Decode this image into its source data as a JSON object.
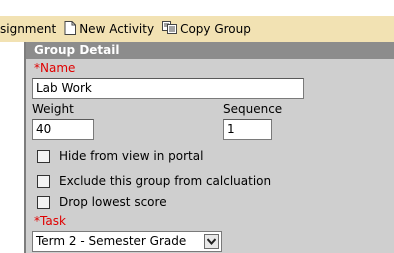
{
  "toolbar": {
    "assignment_label": "signment",
    "new_activity_label": "New Activity",
    "copy_group_label": "Copy Group"
  },
  "panel": {
    "title": "Group Detail",
    "name": {
      "required_mark": "*",
      "label": "Name",
      "value": "Lab Work"
    },
    "weight": {
      "label": "Weight",
      "value": "40"
    },
    "sequence": {
      "label": "Sequence",
      "value": "1"
    },
    "checkboxes": [
      {
        "label": "Hide from view in portal",
        "checked": false
      },
      {
        "label": "Exclude this group from calcluation",
        "checked": false
      },
      {
        "label": "Drop lowest score",
        "checked": false
      }
    ],
    "task": {
      "required_mark": "*",
      "label": "Task",
      "selected": "Term 2 - Semester Grade"
    }
  }
}
